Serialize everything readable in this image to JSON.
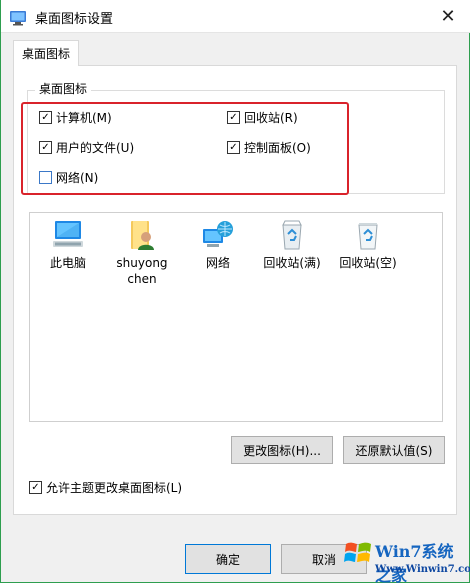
{
  "window": {
    "title": "桌面图标设置",
    "close_symbol": "✕"
  },
  "tab": {
    "label": "桌面图标"
  },
  "group": {
    "legend": "桌面图标",
    "checkboxes": [
      {
        "label": "计算机(M)",
        "checked": true
      },
      {
        "label": "回收站(R)",
        "checked": true
      },
      {
        "label": "用户的文件(U)",
        "checked": true
      },
      {
        "label": "控制面板(O)",
        "checked": true
      },
      {
        "label": "网络(N)",
        "checked": false
      }
    ]
  },
  "icons": [
    {
      "label": "此电脑",
      "icon": "computer-icon"
    },
    {
      "label": "shuyong chen",
      "icon": "user-folder-icon"
    },
    {
      "label": "网络",
      "icon": "network-icon"
    },
    {
      "label": "回收站(满)",
      "icon": "recycle-bin-full-icon"
    },
    {
      "label": "回收站(空)",
      "icon": "recycle-bin-empty-icon"
    }
  ],
  "buttons": {
    "change_icon": "更改图标(H)...",
    "restore_default": "还原默认值(S)",
    "ok": "确定",
    "cancel": "取消"
  },
  "theme_checkbox": {
    "label": "允许主题更改桌面图标(L)",
    "checked": true
  },
  "watermark": {
    "brand": "Win7系统之家",
    "url": "Www.Winwin7.com"
  },
  "check_mark": "✓"
}
